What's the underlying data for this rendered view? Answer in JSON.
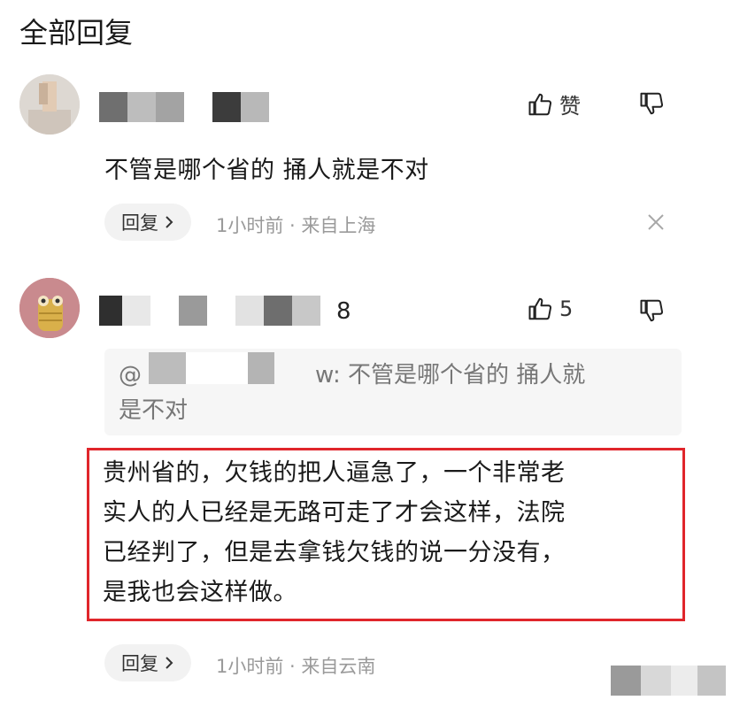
{
  "header": {
    "title": "全部回复"
  },
  "comments": [
    {
      "like_label": "赞",
      "text": "不管是哪个省的 捅人就是不对",
      "reply_label": "回复",
      "meta": "1小时前 · 来自上海"
    },
    {
      "username_tail": "8",
      "like_count": "5",
      "quote_prefix": "@",
      "quote_middle": "w",
      "quote_line1": ": 不管是哪个省的 捅人就",
      "quote_line2": "是不对",
      "text_lines": [
        "贵州省的，欠钱的把人逼急了，一个非常老",
        "实人的人已经是无路可走了才会这样，法院",
        "已经判了，但是去拿钱欠钱的说一分没有，",
        "是我也会这样做。"
      ],
      "reply_label": "回复",
      "meta": "1小时前 · 来自云南"
    }
  ],
  "icons": {
    "like": "thumbs-up-icon",
    "dislike": "thumbs-down-icon",
    "close": "close-icon",
    "chevron": "chevron-right-icon"
  },
  "colors": {
    "highlight": "#e0262b",
    "meta": "#9a9a9a"
  }
}
